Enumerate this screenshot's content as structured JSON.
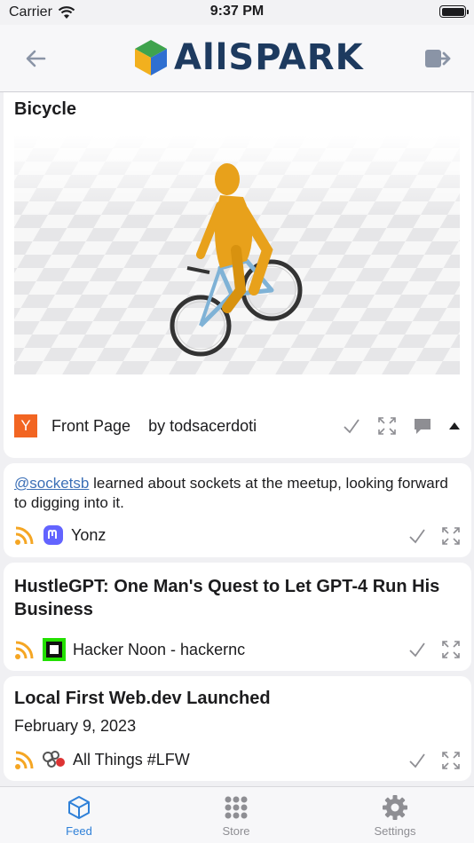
{
  "status_bar": {
    "carrier": "Carrier",
    "time": "9:37 PM"
  },
  "header": {
    "brand": "AllSPARK"
  },
  "feed": {
    "items": [
      {
        "title": "Bicycle",
        "source": "Front Page",
        "author": "by todsacerdoti",
        "source_icon_letter": "Y"
      },
      {
        "mention": "@socketsb",
        "text": " learned about sockets at the meetup, looking forward to digging into it.",
        "source": "Yonz"
      },
      {
        "title": "HustleGPT: One Man's Quest to Let GPT-4 Run His Business",
        "source": "Hacker Noon - hackernc"
      },
      {
        "title": "Local First Web.dev Launched",
        "date": "February 9, 2023",
        "source": "All Things #LFW"
      }
    ]
  },
  "tabbar": {
    "tabs": [
      {
        "label": "Feed",
        "active": true
      },
      {
        "label": "Store",
        "active": false
      },
      {
        "label": "Settings",
        "active": false
      }
    ]
  },
  "colors": {
    "accent": "#2f80d8",
    "rss": "#f5a623",
    "brand": "#1d3a5f",
    "hn_orange": "#f26522"
  }
}
